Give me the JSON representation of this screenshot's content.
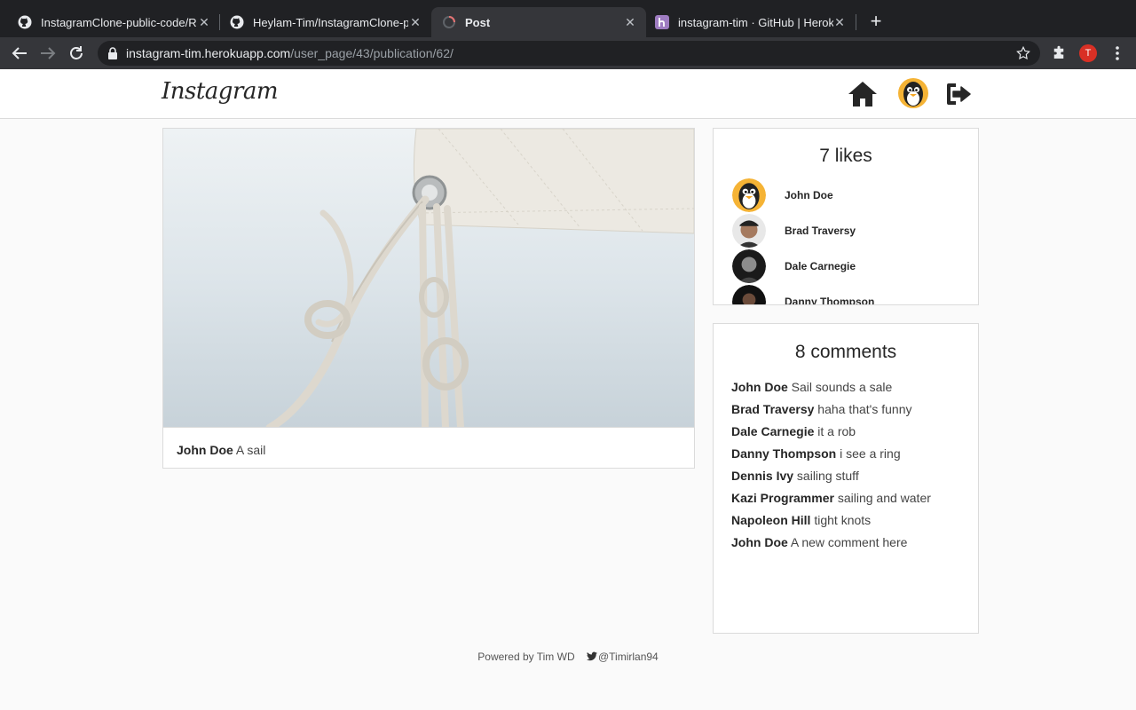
{
  "browser": {
    "tabs": [
      {
        "title": "InstagramClone-public-code/R",
        "icon": "github-icon",
        "active": false
      },
      {
        "title": "Heylam-Tim/InstagramClone-p",
        "icon": "github-icon",
        "active": false
      },
      {
        "title": "Post",
        "icon": "loading-spinner-icon",
        "active": true
      },
      {
        "title": "instagram-tim · GitHub | Herok",
        "icon": "heroku-icon",
        "active": false
      }
    ],
    "url_host": "instagram-tim.herokuapp.com",
    "url_path": "/user_page/43/publication/62/",
    "profile_initial": "T"
  },
  "header": {
    "logo": "Instagram",
    "icons": [
      "home-icon",
      "user-avatar-icon",
      "logout-icon"
    ]
  },
  "post": {
    "author": "John Doe",
    "caption": "A sail"
  },
  "likes": {
    "title": "7 likes",
    "users": [
      {
        "name": "John Doe",
        "avatar": "penguin"
      },
      {
        "name": "Brad Traversy",
        "avatar": "man-cap"
      },
      {
        "name": "Dale Carnegie",
        "avatar": "man-bw"
      },
      {
        "name": "Danny Thompson",
        "avatar": "man-dark"
      }
    ]
  },
  "comments": {
    "title": "8 comments",
    "items": [
      {
        "author": "John Doe",
        "text": "Sail sounds a sale"
      },
      {
        "author": "Brad Traversy",
        "text": "haha that's funny"
      },
      {
        "author": "Dale Carnegie",
        "text": "it a rob"
      },
      {
        "author": "Danny Thompson",
        "text": "i see a ring"
      },
      {
        "author": "Dennis Ivy",
        "text": "sailing stuff"
      },
      {
        "author": "Kazi Programmer",
        "text": "sailing and water"
      },
      {
        "author": "Napoleon Hill",
        "text": "tight knots"
      },
      {
        "author": "John Doe",
        "text": "A new comment here"
      }
    ]
  },
  "footer": {
    "powered": "Powered by Tim WD",
    "twitter": "@Timirlan94"
  }
}
